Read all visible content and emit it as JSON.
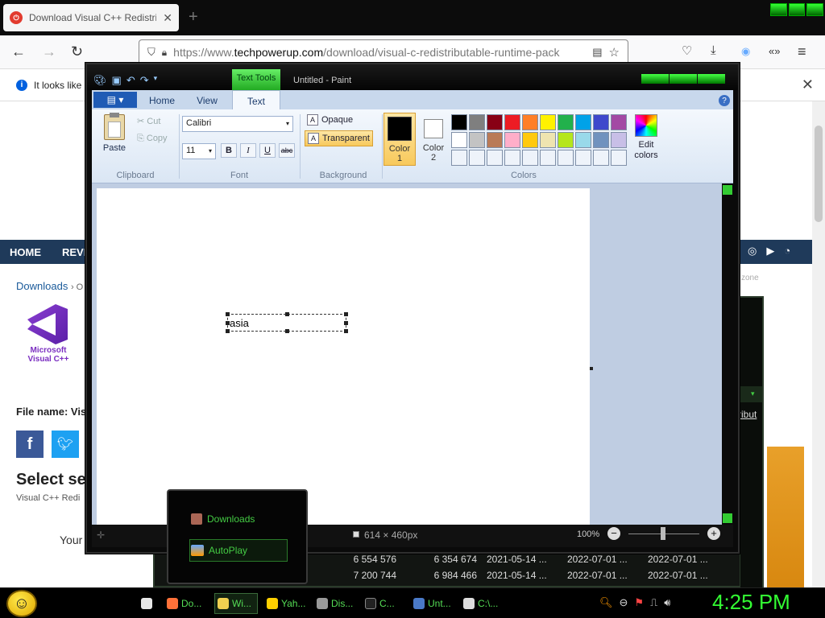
{
  "browser": {
    "tab_title": "Download Visual C++ Redistrib",
    "tab_close": "✕",
    "new_tab": "+",
    "url_prefix": "https://www.",
    "url_domain": "techpowerup.com",
    "url_path": "/download/visual-c-redistributable-runtime-pack",
    "infobar_text": "It looks like"
  },
  "site": {
    "nav": [
      "HOME",
      "REVIE"
    ],
    "breadcrumb": "Downloads",
    "breadcrumb_sep": "›  O",
    "logo_line1": "Microsoft",
    "logo_line2": "Visual C++",
    "file_name_label": "File name: Vis",
    "select_heading": "Select se",
    "vcr_text": "Visual C++ Redi",
    "your_text": "Your",
    "zone_text": "zone",
    "ribut_text": "ribut"
  },
  "bg_table": {
    "rows": [
      [
        "6 554 576",
        "6 354 674",
        "2021-05-14 ...",
        "2022-07-01 ...",
        "2022-07-01 ..."
      ],
      [
        "7 200 744",
        "6 984 466",
        "2021-05-14 ...",
        "2022-07-01 ...",
        "2022-07-01 ..."
      ]
    ]
  },
  "paint": {
    "contextual_tab": "Text Tools",
    "window_title": "Untitled - Paint",
    "tabs": {
      "home": "Home",
      "view": "View",
      "text": "Text"
    },
    "clipboard": {
      "paste": "Paste",
      "cut": "Cut",
      "copy": "Copy",
      "group": "Clipboard"
    },
    "font": {
      "family": "Calibri",
      "size": "11",
      "bold": "B",
      "italic": "I",
      "underline": "U",
      "strike": "abc",
      "group": "Font"
    },
    "background": {
      "opaque": "Opaque",
      "transparent": "Transparent",
      "group": "Background"
    },
    "colors": {
      "color1_l1": "Color",
      "color1_l2": "1",
      "color2_l1": "Color",
      "color2_l2": "2",
      "edit_l1": "Edit",
      "edit_l2": "colors",
      "group": "Colors",
      "palette": [
        "#000000",
        "#7f7f7f",
        "#880015",
        "#ed1c24",
        "#ff7f27",
        "#fff200",
        "#22b14c",
        "#00a2e8",
        "#3f48cc",
        "#a349a4",
        "#ffffff",
        "#c3c3c3",
        "#b97a57",
        "#ffaec9",
        "#ffc90e",
        "#efe4b0",
        "#b5e61d",
        "#99d9ea",
        "#7092be",
        "#c8bfe7",
        "#eef3fa",
        "#eef3fa",
        "#eef3fa",
        "#eef3fa",
        "#eef3fa",
        "#eef3fa",
        "#eef3fa",
        "#eef3fa",
        "#eef3fa",
        "#eef3fa"
      ]
    },
    "text_value": "asia",
    "status": {
      "size": "614 × 460px",
      "zoom": "100%"
    }
  },
  "popup": {
    "item1": "Downloads",
    "item2": "AutoPlay"
  },
  "taskbar": {
    "items": [
      {
        "label": "",
        "color": "#e8e8e8"
      },
      {
        "label": "Do...",
        "color": "#ff7139"
      },
      {
        "label": "Wi...",
        "color": "#f0d050"
      },
      {
        "label": "Yah...",
        "color": "#ffd000"
      },
      {
        "label": "Dis...",
        "color": "#999999"
      },
      {
        "label": "C...",
        "color": "#222222"
      },
      {
        "label": "Unt...",
        "color": "#4a7ac8"
      },
      {
        "label": "C:\\...",
        "color": "#dddddd"
      }
    ],
    "clock": "4:25 PM"
  }
}
